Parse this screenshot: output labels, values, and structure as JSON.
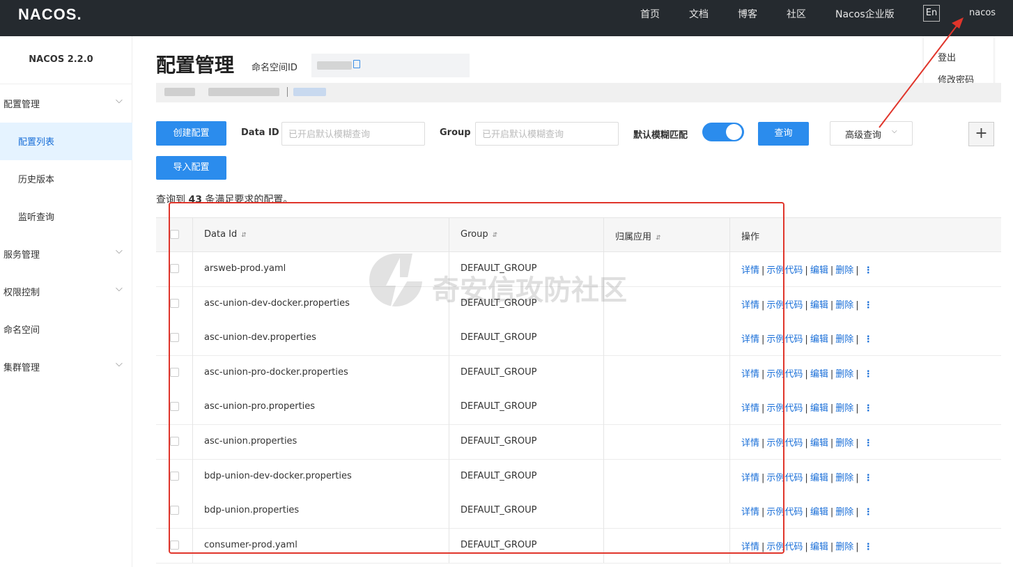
{
  "header": {
    "logo": "NACOS.",
    "nav": [
      "首页",
      "文档",
      "博客",
      "社区",
      "Nacos企业版"
    ],
    "lang_button": "En",
    "user": "nacos",
    "user_menu": [
      "登出",
      "修改密码"
    ]
  },
  "sidebar": {
    "version": "NACOS 2.2.0",
    "items": [
      {
        "label": "配置管理",
        "expandable": true
      },
      {
        "label": "配置列表",
        "selected": true
      },
      {
        "label": "历史版本"
      },
      {
        "label": "监听查询"
      },
      {
        "label": "服务管理",
        "expandable": true
      },
      {
        "label": "权限控制",
        "expandable": true
      },
      {
        "label": "命名空间"
      },
      {
        "label": "集群管理",
        "expandable": true
      }
    ]
  },
  "main": {
    "title": "配置管理",
    "namespace_label": "命名空间ID",
    "create_button": "创建配置",
    "import_button": "导入配置",
    "dataid_label": "Data ID",
    "dataid_placeholder": "已开启默认模糊查询",
    "group_label": "Group",
    "group_placeholder": "已开启默认模糊查询",
    "fuzzy_label": "默认模糊匹配",
    "fuzzy_enabled": true,
    "query_button": "查询",
    "advanced_button": "高级查询",
    "add_button": "+",
    "result_prefix": "查询到",
    "result_count": "43",
    "result_suffix": "条满足要求的配置。"
  },
  "table": {
    "columns": [
      "Data Id",
      "Group",
      "归属应用",
      "操作"
    ],
    "actions": [
      "详情",
      "示例代码",
      "编辑",
      "删除"
    ],
    "rows": [
      {
        "data_id": "arsweb-prod.yaml",
        "group": "DEFAULT_GROUP",
        "app": ""
      },
      {
        "data_id": "asc-union-dev-docker.properties",
        "group": "DEFAULT_GROUP",
        "app": ""
      },
      {
        "data_id": "asc-union-dev.properties",
        "group": "DEFAULT_GROUP",
        "app": ""
      },
      {
        "data_id": "asc-union-pro-docker.properties",
        "group": "DEFAULT_GROUP",
        "app": ""
      },
      {
        "data_id": "asc-union-pro.properties",
        "group": "DEFAULT_GROUP",
        "app": ""
      },
      {
        "data_id": "asc-union.properties",
        "group": "DEFAULT_GROUP",
        "app": ""
      },
      {
        "data_id": "bdp-union-dev-docker.properties",
        "group": "DEFAULT_GROUP",
        "app": ""
      },
      {
        "data_id": "bdp-union.properties",
        "group": "DEFAULT_GROUP",
        "app": ""
      },
      {
        "data_id": "consumer-prod.yaml",
        "group": "DEFAULT_GROUP",
        "app": ""
      }
    ]
  },
  "watermark": "奇安信攻防社区",
  "colors": {
    "accent": "#2b8ced",
    "link": "#1a6fd8",
    "topbar": "#252a2f",
    "annotation": "#e0352b"
  }
}
